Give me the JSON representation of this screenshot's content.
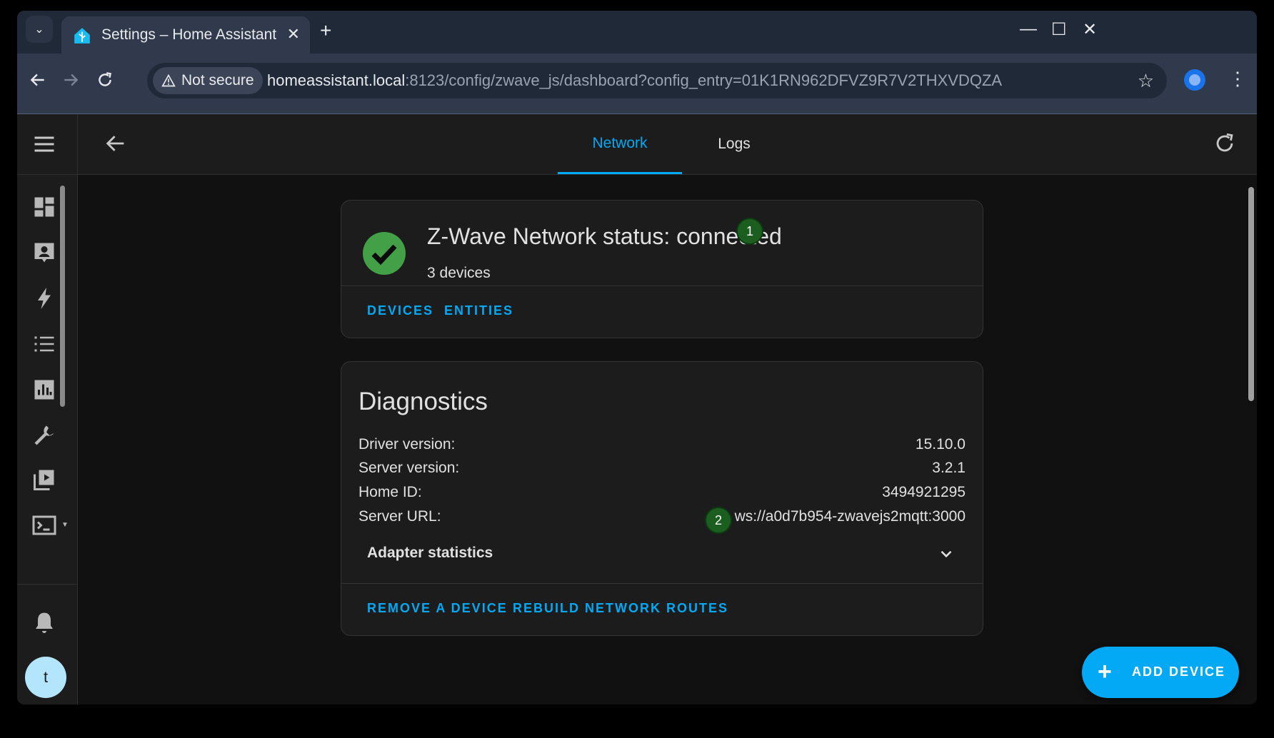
{
  "browser": {
    "tab_title": "Settings – Home Assistant",
    "close_glyph": "✕",
    "new_tab_glyph": "+",
    "security_label": "Not secure",
    "url_host": "homeassistant.local",
    "url_rest": ":8123/config/zwave_js/dashboard?config_entry=01K1RN962DFVZ9R7V2THXVDQZA",
    "icons": [
      "tab-search-icon",
      "home-assistant-favicon",
      "back-icon",
      "forward-icon",
      "reload-icon",
      "warning-icon",
      "star-icon",
      "extension-icon",
      "more-vert-icon",
      "minimize-icon",
      "maximize-icon",
      "close-icon"
    ]
  },
  "sidebar": {
    "items": [
      {
        "icon": "dashboard-icon"
      },
      {
        "icon": "map-person-icon"
      },
      {
        "icon": "lightning-icon"
      },
      {
        "icon": "logbook-list-icon"
      },
      {
        "icon": "history-chart-icon"
      },
      {
        "icon": "wrench-icon"
      },
      {
        "icon": "media-icon"
      },
      {
        "icon": "terminal-icon"
      }
    ],
    "notification_icon": "bell-icon",
    "avatar_initial": "t"
  },
  "header": {
    "tabs": [
      {
        "label": "Network",
        "active": true
      },
      {
        "label": "Logs",
        "active": false
      }
    ]
  },
  "status_card": {
    "title": "Z-Wave Network status: connected",
    "badge": "1",
    "devices": "3 devices",
    "actions": [
      "DEVICES",
      "ENTITIES"
    ]
  },
  "diagnostics": {
    "title": "Diagnostics",
    "rows": [
      {
        "label": "Driver version:",
        "value": "15.10.0"
      },
      {
        "label": "Server version:",
        "value": "3.2.1"
      },
      {
        "label": "Home ID:",
        "value": "3494921295"
      },
      {
        "label": "Server URL:",
        "value": "ws://a0d7b954-zwavejs2mqtt:3000"
      }
    ],
    "url_badge": "2",
    "adapter_label": "Adapter statistics",
    "actions": [
      "REMOVE A DEVICE",
      "REBUILD NETWORK ROUTES"
    ]
  },
  "fab": {
    "label": "ADD DEVICE",
    "plus": "+"
  },
  "colors": {
    "accent": "#03a9f4",
    "success": "#43a047",
    "badge": "#1b5e20",
    "card": "#1c1c1c"
  }
}
